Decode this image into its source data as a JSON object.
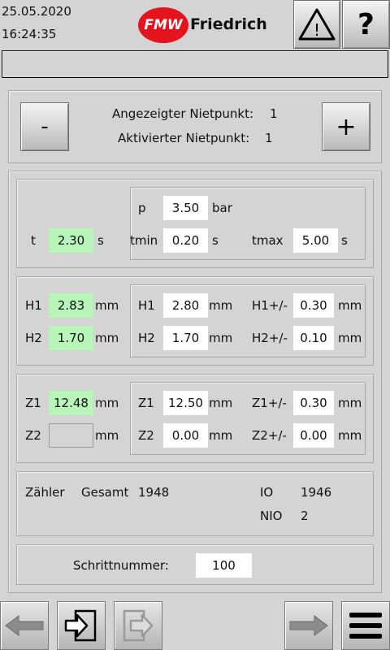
{
  "header": {
    "date": "25.05.2020",
    "time": "16:24:35",
    "logo_badge": "FMW",
    "logo_name": "Friedrich",
    "warning_icon": "warning-triangle-icon",
    "help_label": "?"
  },
  "status_bar": {
    "text": ""
  },
  "rivet": {
    "minus_label": "-",
    "plus_label": "+",
    "displayed_label": "Angezeigter Nietpunkt:",
    "displayed_value": "1",
    "activated_label": "Aktivierter Nietpunkt:",
    "activated_value": "1"
  },
  "pressure": {
    "t_label": "t",
    "t_value": "2.30",
    "t_unit": "s",
    "p_label": "p",
    "p_value": "3.50",
    "p_unit": "bar",
    "tmin_label": "tmin",
    "tmin_value": "0.20",
    "tmin_unit": "s",
    "tmax_label": "tmax",
    "tmax_value": "5.00",
    "tmax_unit": "s"
  },
  "height": {
    "h1_label": "H1",
    "h1_actual": "2.83",
    "h2_label": "H2",
    "h2_actual": "1.70",
    "unit": "mm",
    "h1_set": "2.80",
    "h2_set": "1.70",
    "h1_tol_label": "H1+/-",
    "h1_tol": "0.30",
    "h2_tol_label": "H2+/-",
    "h2_tol": "0.10"
  },
  "z": {
    "z1_label": "Z1",
    "z1_actual": "12.48",
    "z2_label": "Z2",
    "z2_actual": "",
    "unit": "mm",
    "z1_set": "12.50",
    "z2_set": "0.00",
    "z1_tol_label": "Z1+/-",
    "z1_tol": "0.30",
    "z2_tol_label": "Z2+/-",
    "z2_tol": "0.00"
  },
  "counter": {
    "label": "Zähler",
    "total_label": "Gesamt",
    "total_value": "1948",
    "io_label": "IO",
    "io_value": "1946",
    "nio_label": "NIO",
    "nio_value": "2"
  },
  "step": {
    "label": "Schrittnummer:",
    "value": "100"
  },
  "nav": {
    "back_icon": "arrow-left-icon",
    "enter_icon": "enter-icon",
    "exit_icon": "exit-icon",
    "forward_icon": "arrow-right-icon",
    "menu_icon": "hamburger-menu-icon"
  },
  "colors": {
    "background": "#d4d4d4",
    "actual_value_green": "#b8f5b8",
    "brand_red": "#e3141d"
  }
}
